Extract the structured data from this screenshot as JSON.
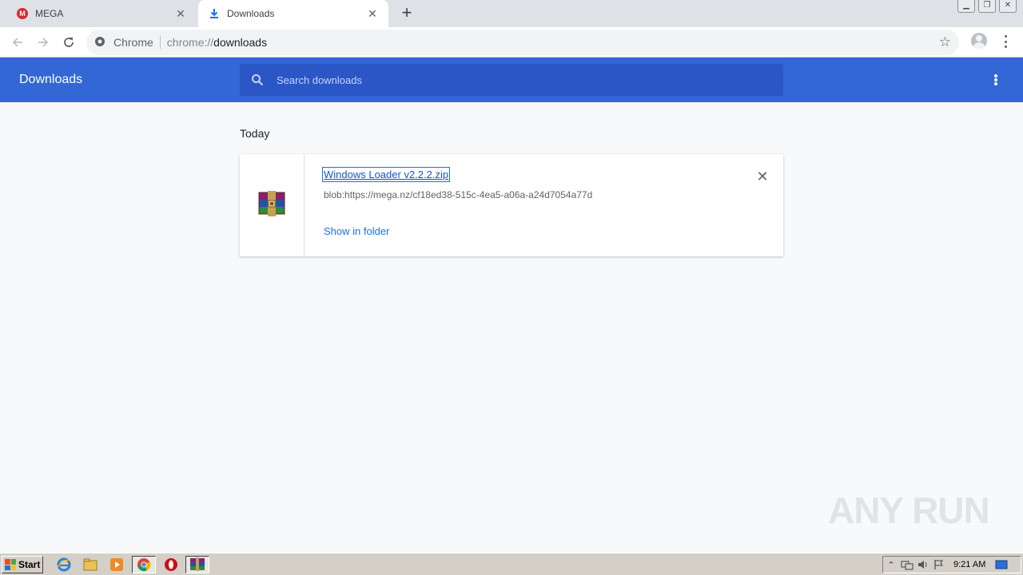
{
  "browser": {
    "tabs": [
      {
        "title": "MEGA",
        "favicon": "mega-logo-icon",
        "active": false
      },
      {
        "title": "Downloads",
        "favicon": "download-icon",
        "active": true
      }
    ],
    "omnibox": {
      "chip_label": "Chrome",
      "url_scheme": "chrome://",
      "url_host": "downloads"
    }
  },
  "downloads_page": {
    "title": "Downloads",
    "search_placeholder": "Search downloads",
    "section_date": "Today",
    "items": [
      {
        "file_name": "Windows Loader v2.2.2.zip",
        "source_url": "blob:https://mega.nz/cf18ed38-515c-4ea5-a06a-a24d7054a77d",
        "action_label": "Show in folder",
        "file_icon": "winrar-archive-icon"
      }
    ]
  },
  "watermark": "ANY RUN",
  "taskbar": {
    "start_label": "Start",
    "clock": "9:21 AM"
  },
  "colors": {
    "header_blue": "#3367d6",
    "search_blue": "#2a56c6",
    "link_blue": "#1a73e8"
  }
}
